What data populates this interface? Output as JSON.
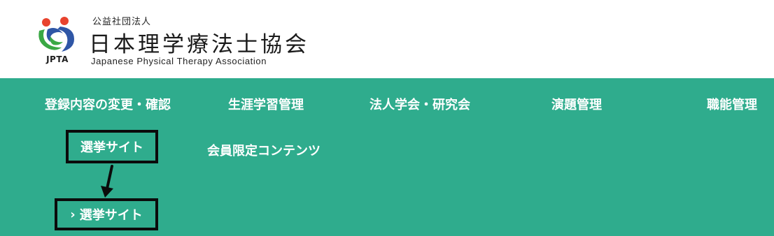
{
  "header": {
    "org_type": "公益社団法人",
    "org_name": "日本理学療法士協会",
    "org_name_en": "Japanese Physical Therapy Association",
    "abbr": "JPTA"
  },
  "nav": {
    "items": [
      {
        "label": "登録内容の変更・確認"
      },
      {
        "label": "生涯学習管理"
      },
      {
        "label": "法人学会・研究会"
      },
      {
        "label": "演題管理"
      },
      {
        "label": "職能管理"
      },
      {
        "label": "選挙サイト"
      },
      {
        "label": "会員限定コンテンツ"
      }
    ],
    "submenu_item": "選挙サイト"
  },
  "colors": {
    "nav_bg": "#2fac8d",
    "highlight": "#0b0b0b",
    "logo_red": "#e8432e",
    "logo_blue": "#2f56a6",
    "logo_green": "#3aa844"
  }
}
